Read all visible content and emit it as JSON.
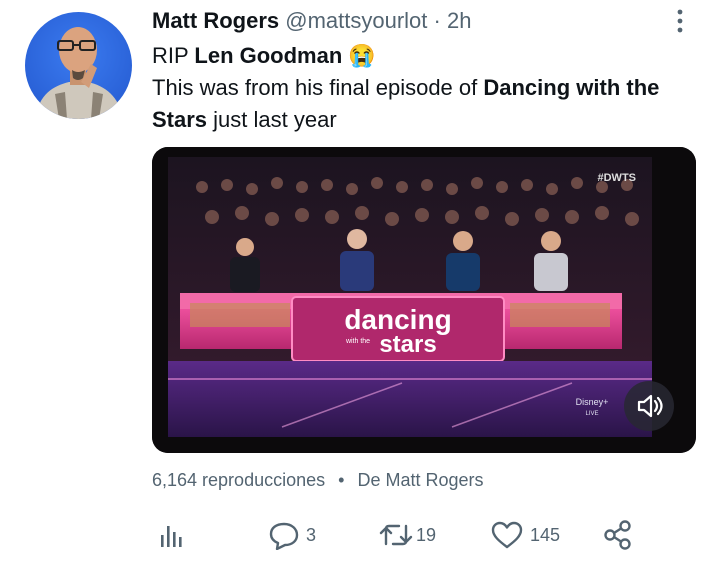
{
  "tweet": {
    "name": "Matt Rogers",
    "handle": "@mattsyourlot",
    "separator": "·",
    "time": "2h",
    "line1_prefix": "RIP ",
    "line1_bold": "Len Goodman",
    "line1_emoji": "😭",
    "line2_prefix": "This was from his final episode of ",
    "line2_bold": "Dancing with the Stars",
    "line2_suffix": " just last year"
  },
  "media": {
    "watermark": "#DWTS",
    "logo_line1": "dancing",
    "logo_with": "with the",
    "logo_line2": "stars",
    "network": "Disney+",
    "network_sub": "LIVE",
    "sound_icon": "speaker-muted-icon"
  },
  "meta": {
    "views": "6,164 reproducciones",
    "dot": "•",
    "from_label": "De",
    "from_name": "Matt Rogers"
  },
  "actions": {
    "analytics_icon": "bar-chart-icon",
    "reply_icon": "reply-bubble-icon",
    "reply_count": "3",
    "retweet_icon": "retweet-icon",
    "retweet_count": "19",
    "like_icon": "heart-icon",
    "like_count": "145",
    "share_icon": "share-icon"
  },
  "colors": {
    "text_primary": "#0f1419",
    "text_secondary": "#536471",
    "avatar_bg": "#2a62d8",
    "stage_pink": "#e23c8c"
  }
}
